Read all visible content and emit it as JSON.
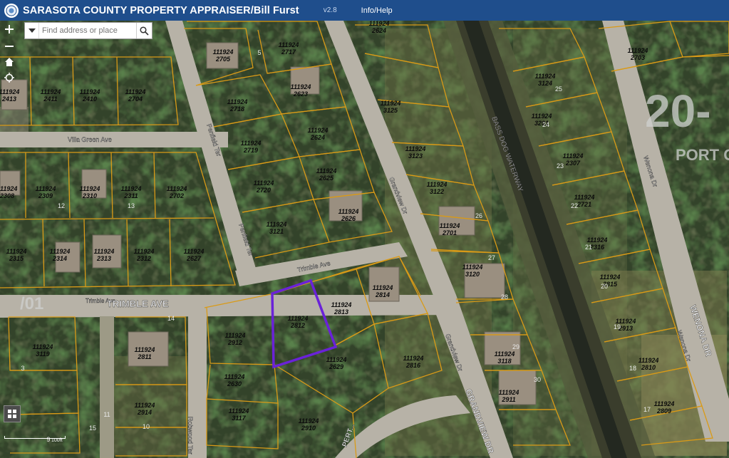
{
  "app": {
    "title": "SARASOTA COUNTY PROPERTY APPRAISER/Bill Furst",
    "version": "v2.8",
    "menu_info": "Info/Help"
  },
  "search": {
    "placeholder": "Find address or place"
  },
  "colors": {
    "header": "#1f4e8c",
    "parcel_line": "#d99a17",
    "selected_parcel": "#6a22d8",
    "road": "#b9b3a6",
    "label": "#101010",
    "road_label": "#f2f2f2"
  },
  "icons": [
    "zoom-in-icon",
    "home-icon",
    "locate-icon",
    "layers-icon",
    "search-icon",
    "chevron-down-icon"
  ],
  "scale_label": "100ft",
  "map": {
    "big_labels": [
      "20-",
      "PORT C",
      "/01"
    ],
    "roads": [
      "Villa Green Ave",
      "Penfield Ter",
      "Trimble Ave",
      "TRIMBLE AVE",
      "Grandview Dr",
      "Grandview Dr",
      "GRANDVIEW DR",
      "BASS DOG WATERWAY",
      "Wenona Dr",
      "WENONA DR",
      "Robwood Ter",
      "PERT..."
    ],
    "parcel_ids": [
      "111924 2705",
      "111924 2717",
      "111924 2624",
      "111924 2413",
      "111924 2411",
      "111924 2410",
      "111924 2704",
      "111924 2718",
      "111924 2623",
      "111924 3125",
      "111924 3124",
      "111924 3201",
      "111924 2703",
      "111924 2719",
      "111924 2624",
      "111924 3123",
      "111924 2307",
      "111924 2308",
      "111924 2309",
      "111924 2310",
      "111924 2311",
      "111924 2702",
      "111924 2720",
      "111924 2625",
      "111924 3122",
      "111924 2721",
      "111924 2626",
      "111924 2701",
      "111924 3121",
      "111924 2316",
      "111924 2315",
      "111924 2314",
      "111924 2313",
      "111924 2312",
      "111924 2627",
      "111924 3120",
      "111924 2815",
      "111924 2814",
      "111924 2813",
      "111924 2812",
      "111924 3119",
      "111924 2912",
      "111924 2913",
      "111924 2811",
      "111924 2816",
      "111924 2629",
      "111924 3118",
      "111924 2810",
      "111924 2630",
      "111924 2911",
      "111924 2914",
      "111924 3117",
      "111924 2809",
      "111924 2910"
    ],
    "lot_numbers": [
      "25",
      "24",
      "23",
      "22",
      "21",
      "20",
      "19",
      "18",
      "17",
      "26",
      "27",
      "28",
      "29",
      "30",
      "11",
      "10",
      "9",
      "14",
      "13",
      "12",
      "15",
      "3",
      "5"
    ]
  }
}
